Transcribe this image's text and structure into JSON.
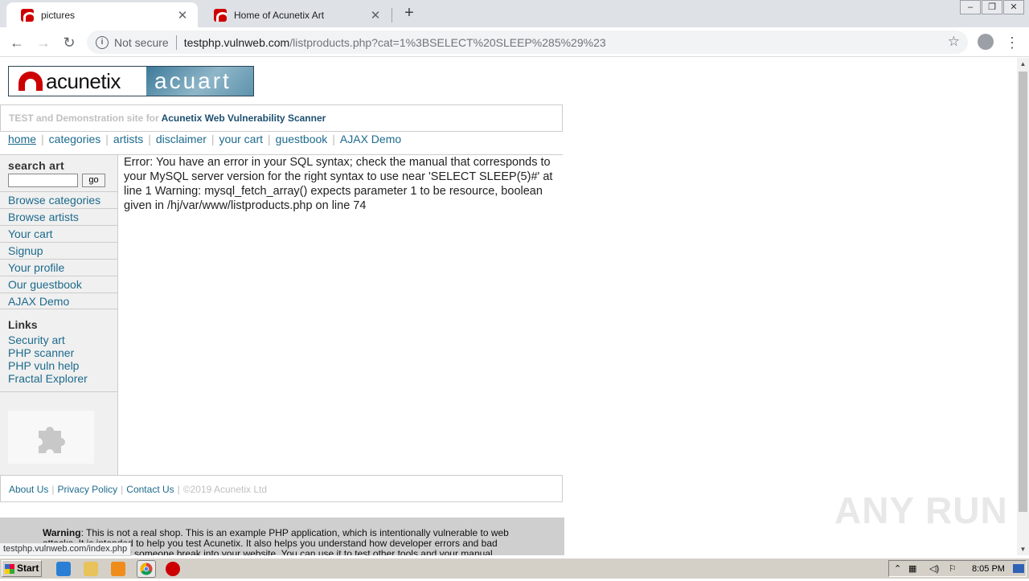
{
  "browser": {
    "tabs": [
      {
        "title": "pictures",
        "close": "✕"
      },
      {
        "title": "Home of Acunetix Art",
        "close": "✕"
      }
    ],
    "new_tab": "+",
    "address": {
      "security": "Not secure",
      "host": "testphp.vulnweb.com",
      "path": "/listproducts.php?cat=1%3BSELECT%20SLEEP%285%29%23"
    },
    "status_url": "testphp.vulnweb.com/index.php"
  },
  "site": {
    "logo_left": "acunetix",
    "logo_right": "acuart",
    "tagline_prefix": "TEST and Demonstration site for",
    "tagline_strong": "Acunetix Web Vulnerability Scanner",
    "nav": [
      "home",
      "categories",
      "artists",
      "disclaimer",
      "your cart",
      "guestbook",
      "AJAX Demo"
    ],
    "search": {
      "title": "search art",
      "button": "go"
    },
    "sidebar_links": [
      "Browse categories",
      "Browse artists",
      "Your cart",
      "Signup",
      "Your profile",
      "Our guestbook",
      "AJAX Demo"
    ],
    "links_title": "Links",
    "external_links": [
      "Security art",
      "PHP scanner",
      "PHP vuln help",
      "Fractal Explorer"
    ],
    "error_text": "Error: You have an error in your SQL syntax; check the manual that corresponds to your MySQL server version for the right syntax to use near 'SELECT SLEEP(5)#' at line 1 Warning: mysql_fetch_array() expects parameter 1 to be resource, boolean given in /hj/var/www/listproducts.php on line 74",
    "footer": {
      "about": "About Us",
      "privacy": "Privacy Policy",
      "contact": "Contact Us",
      "copyright": "©2019 Acunetix Ltd"
    },
    "warning": {
      "label": "Warning",
      "text": ": This is not a real shop. This is an example PHP application, which is intentionally vulnerable to web attacks. It is intended to help you test Acunetix. It also helps you understand how developer errors and bad configuration may let someone break into your website. You can use it to test other tools and your manual hacking skills as well."
    }
  },
  "watermark": "ANY RUN",
  "taskbar": {
    "start": "Start",
    "clock": "8:05 PM"
  },
  "colors": {
    "link": "#1d6a8c",
    "brand_red": "#cc0000"
  }
}
